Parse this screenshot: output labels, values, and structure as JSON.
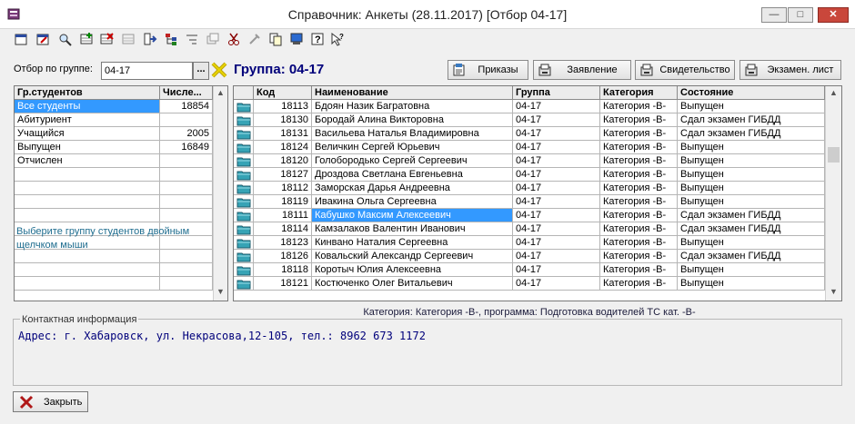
{
  "window": {
    "title": "Справочник: Анкеты (28.11.2017) [Отбор 04-17]",
    "minimize_label": "—",
    "maximize_label": "□",
    "close_label": "✕"
  },
  "toolbar": {
    "icons": [
      "new-record-icon",
      "edit-record-icon",
      "find-icon",
      "add-row-icon",
      "delete-row-icon",
      "copy-row-icon",
      "move-to-group-icon",
      "hierarchy-icon",
      "filter-icon",
      "multi-window-icon",
      "cut-icon",
      "tools-icon",
      "copy-icon",
      "print-preview-icon",
      "help-icon",
      "context-help-icon"
    ]
  },
  "filter": {
    "label": "Отбор по группе:",
    "value": "04-17",
    "browse_label": "..."
  },
  "group_heading": "Группа: 04-17",
  "actions": {
    "orders": "Приказы",
    "application": "Заявление",
    "certificate": "Свидетельство",
    "exam_sheet": "Экзамен. лист"
  },
  "groups_grid": {
    "headers": [
      "Гр.студентов",
      "Числе..."
    ],
    "rows": [
      {
        "name": "Все студенты",
        "count": "18854"
      },
      {
        "name": "Абитуриент",
        "count": ""
      },
      {
        "name": "Учащийся",
        "count": "2005"
      },
      {
        "name": "Выпущен",
        "count": "16849"
      },
      {
        "name": "Отчислен",
        "count": ""
      }
    ],
    "hint": "Выберите группу студентов двойным щелчком мыши"
  },
  "students_grid": {
    "headers": [
      "Код",
      "Наименование",
      "Группа",
      "Категория",
      "Состояние"
    ],
    "rows": [
      {
        "code": "18113",
        "name": "Бдоян Назик Багратовна",
        "group": "04-17",
        "category": "Категория -В-",
        "status": "Выпущен"
      },
      {
        "code": "18130",
        "name": "Бородай Алина Викторовна",
        "group": "04-17",
        "category": "Категория -В-",
        "status": "Сдал экзамен ГИБДД"
      },
      {
        "code": "18131",
        "name": "Васильева Наталья Владимировна",
        "group": "04-17",
        "category": "Категория -В-",
        "status": "Сдал экзамен ГИБДД"
      },
      {
        "code": "18124",
        "name": "Величкин Сергей Юрьевич",
        "group": "04-17",
        "category": "Категория -В-",
        "status": "Выпущен"
      },
      {
        "code": "18120",
        "name": "Голобородько Сергей Сергеевич",
        "group": "04-17",
        "category": "Категория -В-",
        "status": "Выпущен"
      },
      {
        "code": "18127",
        "name": "Дроздова Светлана Евгеньевна",
        "group": "04-17",
        "category": "Категория -В-",
        "status": "Выпущен"
      },
      {
        "code": "18112",
        "name": "Заморская Дарья Андреевна",
        "group": "04-17",
        "category": "Категория -В-",
        "status": "Выпущен"
      },
      {
        "code": "18119",
        "name": "Ивакина Ольга Сергеевна",
        "group": "04-17",
        "category": "Категория -В-",
        "status": "Выпущен"
      },
      {
        "code": "18111",
        "name": "Кабушко Максим Алексеевич",
        "group": "04-17",
        "category": "Категория -В-",
        "status": "Сдал экзамен ГИБДД"
      },
      {
        "code": "18114",
        "name": "Камзалаков Валентин Иванович",
        "group": "04-17",
        "category": "Категория -В-",
        "status": "Сдал экзамен ГИБДД"
      },
      {
        "code": "18123",
        "name": "Кинвано Наталия Сергеевна",
        "group": "04-17",
        "category": "Категория -В-",
        "status": "Выпущен"
      },
      {
        "code": "18126",
        "name": "Ковальский Александр Сергеевич",
        "group": "04-17",
        "category": "Категория -В-",
        "status": "Сдал экзамен ГИБДД"
      },
      {
        "code": "18118",
        "name": "Коротыч Юлия Алексеевна",
        "group": "04-17",
        "category": "Категория -В-",
        "status": "Выпущен"
      },
      {
        "code": "18121",
        "name": "Костюченко Олег Витальевич",
        "group": "04-17",
        "category": "Категория -В-",
        "status": "Выпущен"
      }
    ]
  },
  "status_line": "Категория: Категория -В-, программа: Подготовка водителей ТС кат. -В-",
  "contact": {
    "legend": "Контактная информация",
    "text": "Адрес: г. Хабаровск, ул. Некрасова,12-105, тел.: 8962 673 1172"
  },
  "close_button": "Закрыть",
  "colors": {
    "selection": "#3399ff",
    "heading_blue": "#00007b",
    "hint_teal": "#1f6d8f",
    "folder": "#36a3b5"
  }
}
